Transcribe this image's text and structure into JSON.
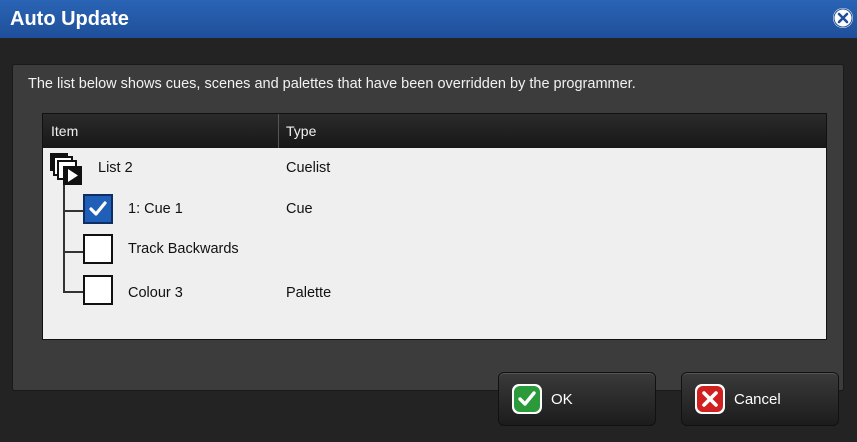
{
  "window": {
    "title": "Auto Update"
  },
  "description": "The list below shows cues, scenes and palettes that have been overridden by the programmer.",
  "list": {
    "columns": [
      "Item",
      "Type"
    ],
    "rows": [
      {
        "item": "List 2",
        "type": "Cuelist",
        "kind": "list-icon"
      },
      {
        "item": "1: Cue 1",
        "type": "Cue",
        "checked": true
      },
      {
        "item": "Track Backwards",
        "type": "",
        "checked": false
      },
      {
        "item": "Colour 3",
        "type": "Palette",
        "checked": false
      }
    ]
  },
  "buttons": {
    "ok": "OK",
    "cancel": "Cancel"
  },
  "colors": {
    "titlebar": "#2a64b5",
    "check": "#1f5fb8",
    "ok_icon": "#2a9a3a",
    "cancel_icon": "#d02020"
  }
}
